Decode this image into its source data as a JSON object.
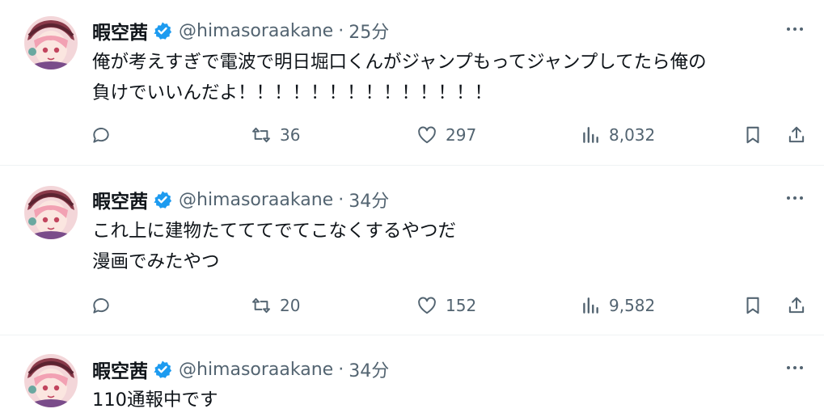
{
  "user": {
    "display_name": "暇空茜",
    "handle": "@himasoraakane",
    "separator": "·"
  },
  "icons": {
    "verified": "verified-badge-icon",
    "more": "more-horizontal-icon",
    "reply": "reply-icon",
    "retweet": "retweet-icon",
    "like": "heart-icon",
    "views": "views-chart-icon",
    "bookmark": "bookmark-icon",
    "share": "share-icon"
  },
  "colors": {
    "verified": "#1d9bf0",
    "secondary": "#536471",
    "text": "#0f1419"
  },
  "tweets": [
    {
      "time": "25分",
      "text": "俺が考えすぎで電波で明日堀口くんがジャンプもってジャンプしてたら俺の\n負けでいいんだよ！！！！！！！！！！！！！！",
      "retweets": "36",
      "likes": "297",
      "views": "8,032"
    },
    {
      "time": "34分",
      "text": "これ上に建物たてててでてこなくするやつだ\n漫画でみたやつ",
      "retweets": "20",
      "likes": "152",
      "views": "9,582"
    },
    {
      "time": "34分",
      "text": "110通報中です"
    }
  ]
}
